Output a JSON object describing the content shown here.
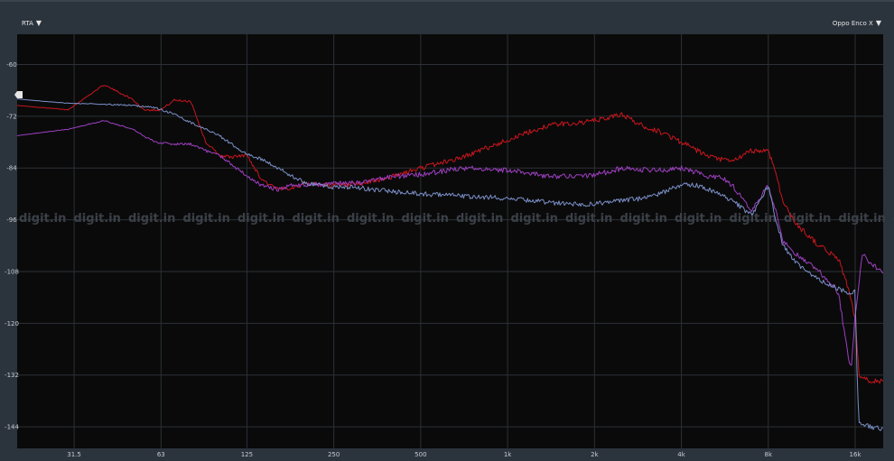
{
  "ui": {
    "left_dropdown": {
      "label": "RTA",
      "caret": "▼"
    },
    "right_dropdown": {
      "label": "Oppo Enco X",
      "caret": "▼"
    },
    "watermark": "digit.in",
    "colors": {
      "background": "#2b333c",
      "plot_background": "#0a0a0a",
      "grid": "#2c3136",
      "marker": "#e6e6e6"
    }
  },
  "chart_data": {
    "type": "line",
    "title": "",
    "xlabel": "",
    "ylabel": "",
    "x_scale": "log",
    "xlim": [
      20,
      20000
    ],
    "ylim": [
      -149,
      -53
    ],
    "grid": true,
    "y_ticks": [
      -60,
      -72,
      -84,
      -96,
      -108,
      -120,
      -132,
      -144
    ],
    "x_ticks": [
      {
        "value": 31.5,
        "label": "31.5"
      },
      {
        "value": 63,
        "label": "63"
      },
      {
        "value": 125,
        "label": "125"
      },
      {
        "value": 250,
        "label": "250"
      },
      {
        "value": 500,
        "label": "500"
      },
      {
        "value": 1000,
        "label": "1k"
      },
      {
        "value": 2000,
        "label": "2k"
      },
      {
        "value": 4000,
        "label": "4k"
      },
      {
        "value": 8000,
        "label": "8k"
      },
      {
        "value": 16000,
        "label": "16k"
      }
    ],
    "marker_level": -67,
    "series": [
      {
        "color": "#c8161d",
        "noise": 0.6,
        "x": [
          20,
          30,
          40,
          50,
          55,
          63,
          70,
          80,
          90,
          100,
          110,
          125,
          140,
          160,
          180,
          200,
          250,
          300,
          400,
          500,
          700,
          1000,
          1400,
          1800,
          2200,
          2500,
          2700,
          3000,
          3500,
          4000,
          5000,
          6000,
          7000,
          8000,
          8500,
          9000,
          10000,
          12000,
          14000,
          15000,
          16000,
          16500,
          17000,
          20000
        ],
        "y": [
          -69.5,
          -70.5,
          -64.7,
          -68,
          -70.5,
          -70.5,
          -68.3,
          -68.5,
          -78,
          -81,
          -81.5,
          -81,
          -86.5,
          -89,
          -88.5,
          -87.5,
          -88,
          -88,
          -86,
          -84,
          -81.5,
          -77.5,
          -74,
          -73.5,
          -72.5,
          -71.5,
          -73,
          -74.5,
          -76,
          -78,
          -81.5,
          -82.5,
          -80,
          -80,
          -85,
          -92,
          -97,
          -102,
          -105,
          -111,
          -119,
          -132,
          -133,
          -133.5
        ]
      },
      {
        "color": "#9d3fc1",
        "noise": 0.6,
        "x": [
          20,
          30,
          40,
          50,
          60,
          70,
          80,
          90,
          100,
          120,
          140,
          160,
          180,
          200,
          250,
          300,
          400,
          500,
          700,
          1000,
          1400,
          1800,
          2200,
          2500,
          3000,
          3500,
          4000,
          5000,
          5500,
          6000,
          7000,
          8000,
          8500,
          9000,
          10000,
          12000,
          14000,
          15000,
          15500,
          16000,
          17000,
          18000,
          20000
        ],
        "y": [
          -76.5,
          -75,
          -73,
          -75,
          -78,
          -78.5,
          -78.5,
          -80,
          -81,
          -85,
          -88,
          -89,
          -88,
          -88,
          -87.5,
          -87.5,
          -86,
          -85.5,
          -84,
          -84.5,
          -86,
          -86,
          -85,
          -84,
          -84.5,
          -84.5,
          -84,
          -86,
          -86,
          -88,
          -94,
          -88,
          -94,
          -101,
          -104,
          -108,
          -113,
          -126,
          -131,
          -118,
          -103.5,
          -106,
          -108
        ]
      },
      {
        "color": "#7b8fc8",
        "noise": 0.55,
        "x": [
          20,
          30,
          40,
          50,
          60,
          70,
          80,
          90,
          100,
          120,
          140,
          160,
          180,
          200,
          250,
          300,
          400,
          500,
          700,
          1000,
          1400,
          1800,
          2200,
          2500,
          3000,
          3500,
          4000,
          4500,
          5000,
          6000,
          7000,
          8000,
          8500,
          9000,
          10000,
          12000,
          14000,
          15000,
          15500,
          16000,
          16200,
          16500,
          18000,
          20000
        ],
        "y": [
          -68,
          -69,
          -69.2,
          -69.5,
          -70,
          -71.5,
          -73.5,
          -75,
          -76.5,
          -80,
          -82,
          -84,
          -86,
          -87.5,
          -88.5,
          -88.5,
          -89.5,
          -90,
          -90.5,
          -91,
          -92,
          -92.5,
          -92,
          -91.5,
          -91,
          -89.5,
          -88,
          -88,
          -89,
          -91.5,
          -95,
          -88,
          -96,
          -102,
          -106,
          -110,
          -112,
          -113,
          -113,
          -112,
          -130,
          -143,
          -144,
          -144.5
        ]
      }
    ]
  }
}
